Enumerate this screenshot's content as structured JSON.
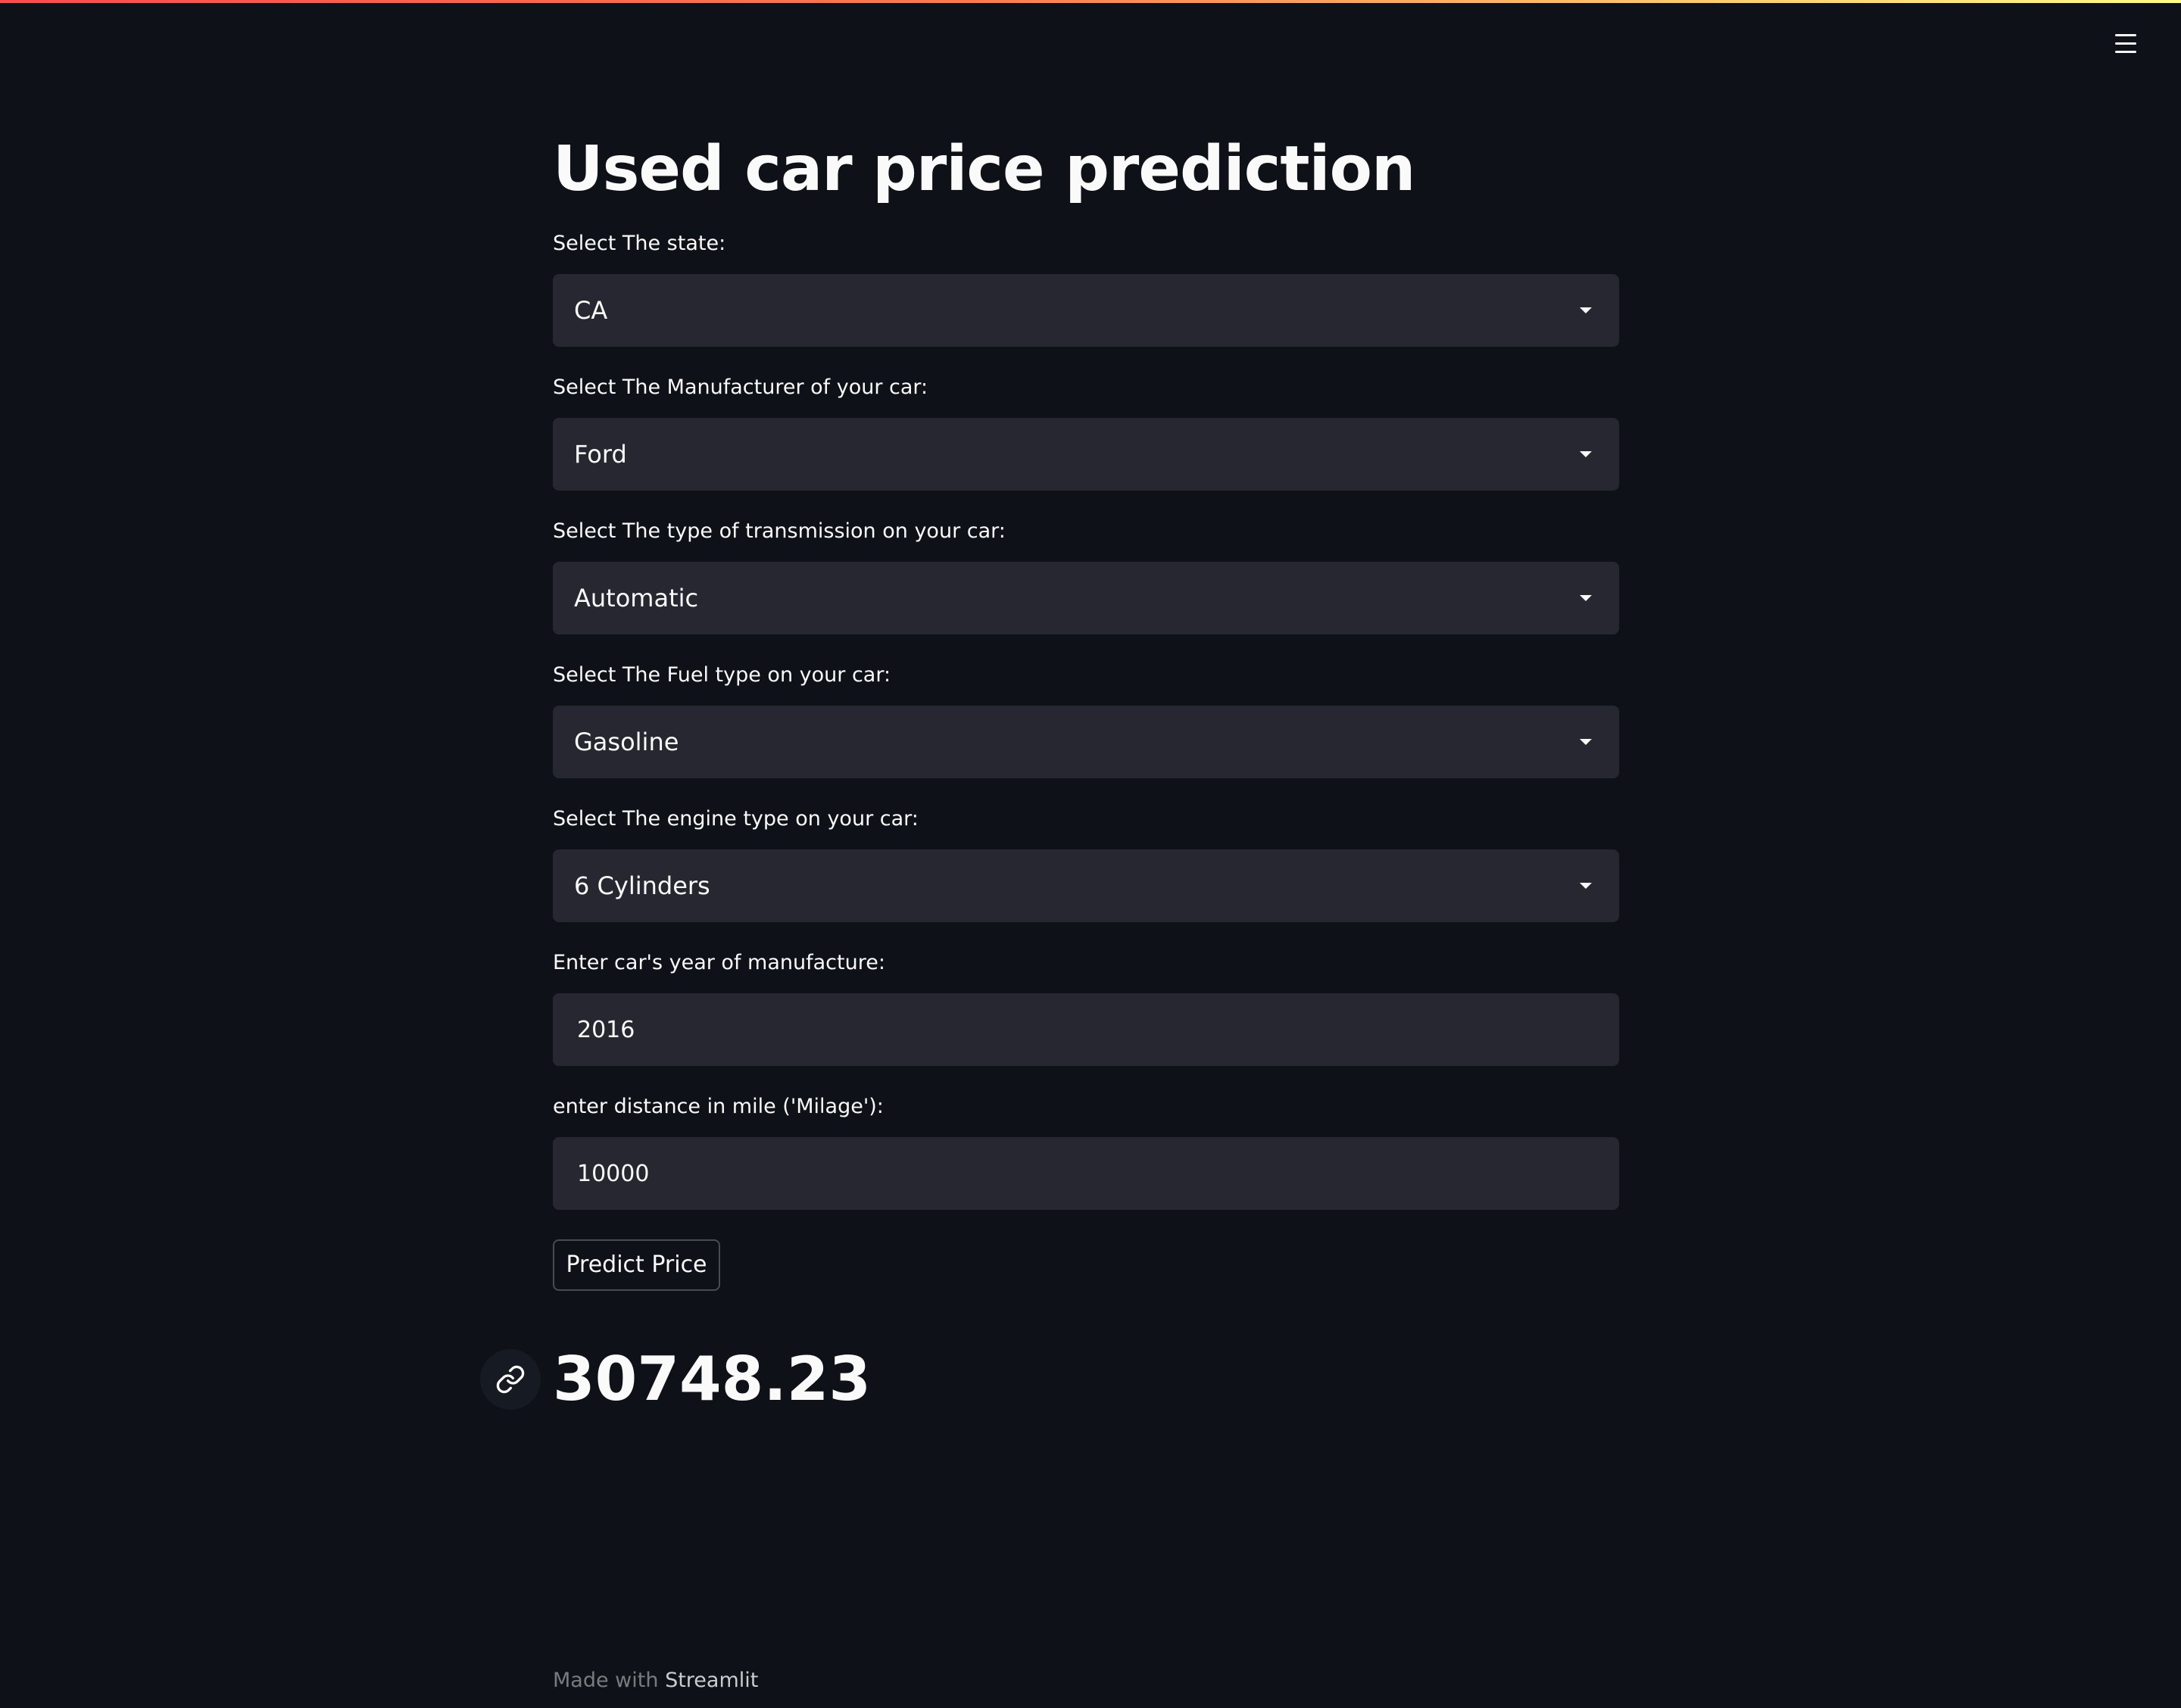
{
  "app": {
    "title": "Used car price prediction",
    "menu_icon": "hamburger-menu-icon"
  },
  "form": {
    "state": {
      "label": "Select The state:",
      "value": "CA"
    },
    "manufacturer": {
      "label": "Select The Manufacturer of your car:",
      "value": "Ford"
    },
    "transmission": {
      "label": "Select The type of transmission on your car:",
      "value": "Automatic"
    },
    "fuel": {
      "label": "Select The Fuel type on your car:",
      "value": "Gasoline"
    },
    "engine": {
      "label": "Select The engine type on your car:",
      "value": "6 Cylinders"
    },
    "year": {
      "label": "Enter car's year of manufacture:",
      "value": "2016"
    },
    "mileage": {
      "label": "enter distance in mile ('Milage'):",
      "value": "10000"
    },
    "predict_label": "Predict Price"
  },
  "result": {
    "value": "30748.23",
    "anchor_icon": "link-icon"
  },
  "footer": {
    "prefix": "Made with",
    "brand": "Streamlit"
  },
  "colors": {
    "background": "#0e1117",
    "input_background": "#262730",
    "text": "#fafafa"
  }
}
